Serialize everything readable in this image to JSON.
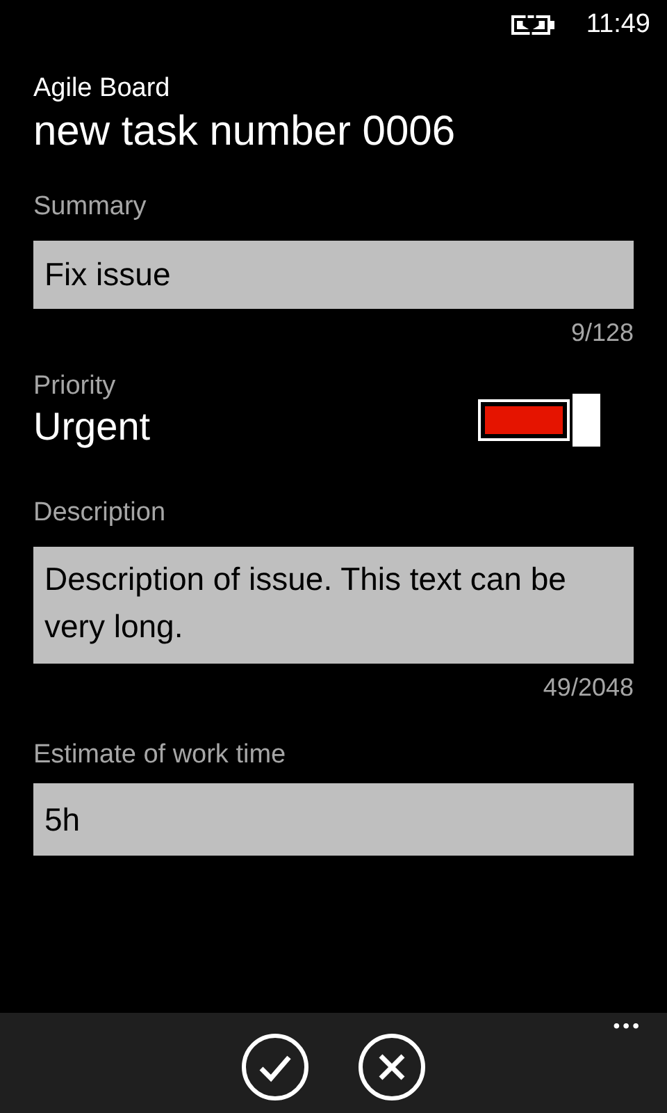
{
  "status_bar": {
    "time": "11:49"
  },
  "app": {
    "title": "Agile Board"
  },
  "page": {
    "title": "new task number 0006"
  },
  "summary": {
    "label": "Summary",
    "value": "Fix issue",
    "count": "9/128"
  },
  "priority": {
    "label": "Priority",
    "value": "Urgent",
    "on": true
  },
  "description": {
    "label": "Description",
    "value": "Description of issue. This text can be very long.",
    "count": "49/2048"
  },
  "estimate": {
    "label": "Estimate of work time",
    "value": "5h"
  },
  "app_bar": {
    "buttons": [
      {
        "kind": "save"
      },
      {
        "kind": "cancel"
      }
    ],
    "more": "•••"
  }
}
